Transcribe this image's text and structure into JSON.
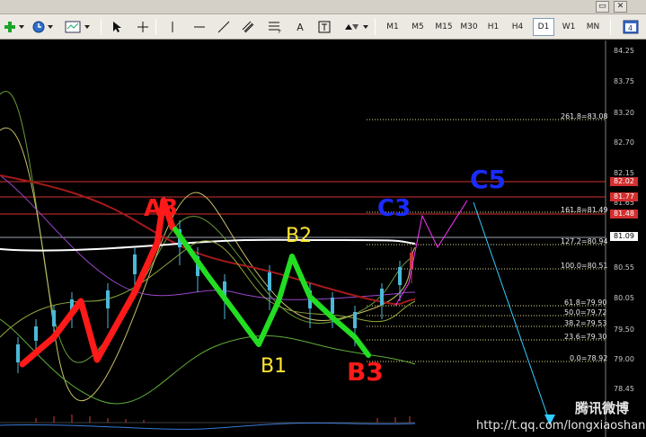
{
  "toolbar": {
    "items": [
      {
        "id": "new-order",
        "icon": "plus-green-icon"
      },
      {
        "id": "history",
        "icon": "clock-icon"
      },
      {
        "id": "template",
        "icon": "chart-template-icon"
      },
      {
        "id": "cursor",
        "icon": "cursor-arrow-icon"
      },
      {
        "id": "crosshair",
        "icon": "crosshair-icon"
      },
      {
        "id": "vline",
        "icon": "vertical-line-icon"
      },
      {
        "id": "hline",
        "icon": "horizontal-line-icon"
      },
      {
        "id": "trendline",
        "icon": "trend-line-icon"
      },
      {
        "id": "equidistant",
        "icon": "equidistant-channel-icon"
      },
      {
        "id": "fibo",
        "icon": "fibonacci-icon"
      },
      {
        "id": "text",
        "label": "A"
      },
      {
        "id": "text-label",
        "icon": "text-label-icon"
      },
      {
        "id": "arrows",
        "icon": "arrows-icon"
      }
    ],
    "timeframes": [
      "M1",
      "M5",
      "M15",
      "M30",
      "H1",
      "H4",
      "D1",
      "W1",
      "MN"
    ],
    "active_timeframe": "D1"
  },
  "price_scale": [
    "84.25",
    "83.75",
    "83.20",
    "82.70",
    "82.15",
    "81.65",
    "80.55",
    "80.05",
    "79.50",
    "79.00",
    "78.45"
  ],
  "price_tags": [
    {
      "text": "82.02",
      "bg": "#d32f2f",
      "fg": "#ffffff"
    },
    {
      "text": "81.77",
      "bg": "#d32f2f",
      "fg": "#ffffff"
    },
    {
      "text": "81.48",
      "bg": "#d32f2f",
      "fg": "#ffffff"
    },
    {
      "text": "81.09",
      "bg": "#ffffff",
      "fg": "#000000"
    }
  ],
  "fib_levels": [
    "261.8=83.08",
    "161.8=81.49",
    "127.2=80.94",
    "100.0=80.51",
    "61.8=79.90",
    "50.0=79.72",
    "38.2=79.53",
    "23.6=79.30",
    "0.0=78.92"
  ],
  "annotations": {
    "a3": "A3",
    "b2": "B2",
    "b1": "B1",
    "b3": "B3",
    "c3": "C3",
    "c5": "C5"
  },
  "watermark": {
    "url": "http://t.qq.com/longxiaoshanhe",
    "logo": "腾讯微博"
  },
  "colors": {
    "background": "#000000",
    "wave_red": "#ff1a1a",
    "wave_green": "#22dd22",
    "annotation_blue": "#1a2bff",
    "annotation_yellow": "#ffe633",
    "projection_magenta": "#ff33ff",
    "projection_cyan": "#33ccff"
  }
}
